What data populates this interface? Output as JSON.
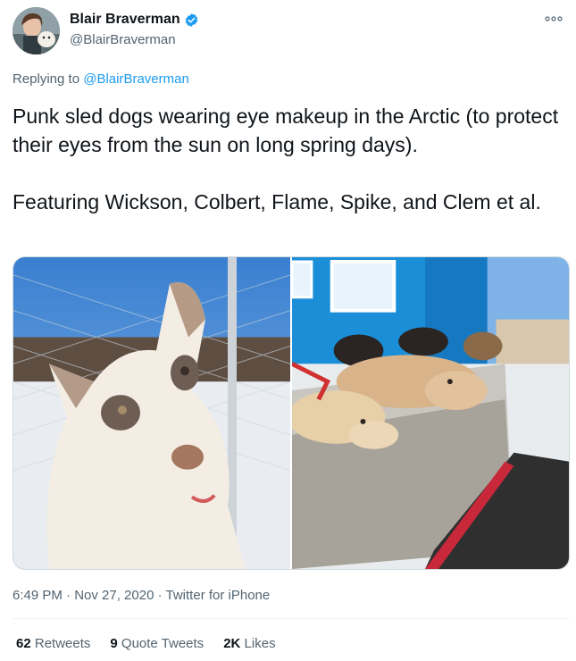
{
  "author": {
    "display_name": "Blair Braverman",
    "handle": "@BlairBraverman",
    "verified": true
  },
  "icons": {
    "verified": "verified-badge-icon",
    "more": "more-options-icon"
  },
  "reply": {
    "prefix": "Replying to",
    "target": "@BlairBraverman"
  },
  "tweet": {
    "text": "Punk sled dogs wearing eye makeup in the Arctic (to protect their eyes from the sun on long spring days).\n\nFeaturing Wickson, Colbert, Flame, Spike, and Clem et al."
  },
  "meta": {
    "timestamp": "6:49 PM · Nov 27, 2020",
    "separator": "·",
    "source": "Twitter for iPhone"
  },
  "stats": {
    "retweets_count": "62",
    "retweets_label": "Retweets",
    "quotes_count": "9",
    "quotes_label": "Quote Tweets",
    "likes_count": "2K",
    "likes_label": "Likes"
  },
  "colors": {
    "accent": "#1d9bf0",
    "secondary_text": "#536471",
    "primary_text": "#0f1419"
  }
}
